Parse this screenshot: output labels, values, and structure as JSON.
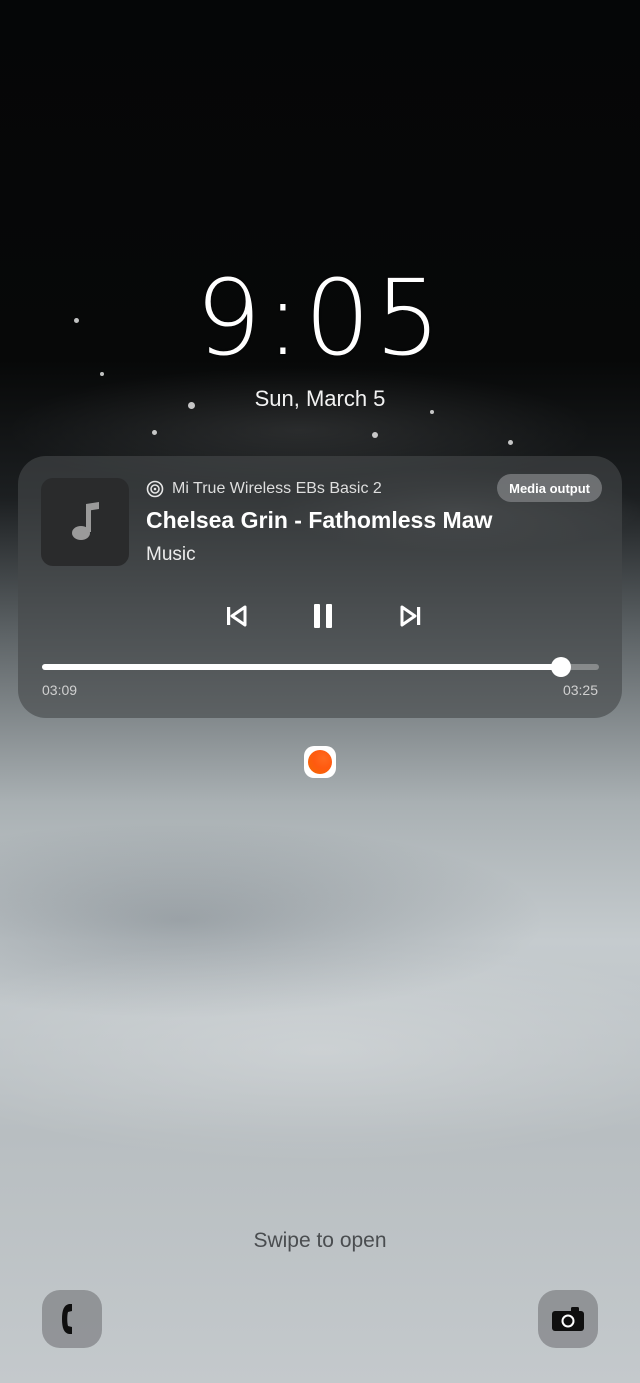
{
  "lockscreen": {
    "time": "9:05",
    "date": "Sun, March 5",
    "swipe_hint": "Swipe to open"
  },
  "media": {
    "device": "Mi True Wireless EBs Basic 2",
    "output_button": "Media output",
    "title": "Chelsea Grin - Fathomless Maw",
    "app": "Music",
    "elapsed": "03:09",
    "total": "03:25",
    "progress_fraction": 0.9317,
    "icons": {
      "album_art": "music-note-icon",
      "device": "earbuds-icon",
      "previous": "previous-track-icon",
      "pause": "pause-icon",
      "next": "next-track-icon"
    }
  },
  "notification_icon": "notification-app-icon",
  "shortcuts": {
    "left": "phone-icon",
    "right": "camera-icon"
  }
}
